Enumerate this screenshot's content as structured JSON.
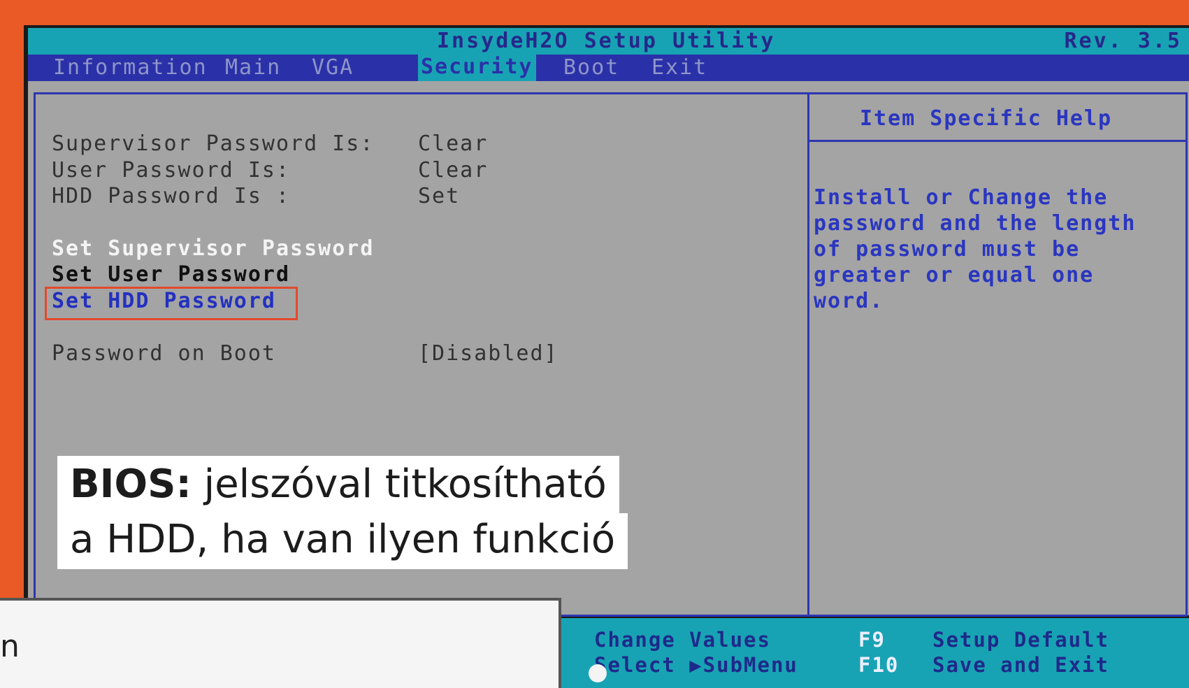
{
  "window": {
    "title": "InsydeH2O Setup Utility",
    "rev": "Rev. 3.5"
  },
  "menu": {
    "items": [
      {
        "label": "Information"
      },
      {
        "label": "Main"
      },
      {
        "label": "VGA"
      },
      {
        "label": "Security",
        "active": true
      },
      {
        "label": "Boot"
      },
      {
        "label": "Exit"
      }
    ]
  },
  "status": [
    {
      "label": "Supervisor Password Is:",
      "value": "Clear"
    },
    {
      "label": "User Password Is:",
      "value": "Clear"
    },
    {
      "label": "HDD Password Is :",
      "value": "Set"
    }
  ],
  "actions": {
    "set_supervisor": "Set Supervisor Password",
    "set_user": "Set User Password",
    "set_hdd": "Set HDD Password"
  },
  "boot_option": {
    "label": "Password on Boot",
    "value": "[Disabled]"
  },
  "help": {
    "title": "Item Specific Help",
    "text": "Install or Change the password and the length of password must be greater or equal one word."
  },
  "footer": {
    "change_values": "Change Values",
    "select_submenu": "Select ▶SubMenu",
    "f9_key": "F9",
    "f9_label": "Setup Default",
    "f10_key": "F10",
    "f10_label": "Save and Exit"
  },
  "caption": {
    "bold": "BIOS:",
    "line1": "jelszóval titkosítható",
    "line2": "a HDD, ha van ilyen funkció"
  },
  "overlay": {
    "partial_glyph": "n"
  },
  "colors": {
    "frame": "#ea5a26",
    "title_bg": "#18a3b4",
    "menu_bg": "#2a31a8",
    "panel_bg": "#a4a4a4",
    "highlight_box": "#e24a2c"
  }
}
